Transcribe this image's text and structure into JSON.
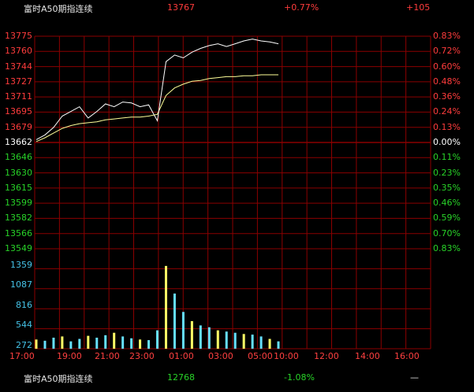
{
  "header": {
    "name": "富时A50期指连续",
    "price": "13767",
    "change_pct": "+0.77%",
    "change_abs": "+105"
  },
  "footer": {
    "name": "富时A50期指连续",
    "price": "12768",
    "change_pct": "-1.08%",
    "extra": "—"
  },
  "colors": {
    "grid": "#8b0000",
    "price_line": "#ffffff",
    "avg_line": "#ffff99",
    "up": "#ff3c3c",
    "down": "#28d228",
    "volume_label": "#45c3e8"
  },
  "chart_data": {
    "type": "line",
    "price_axis": [
      "13775",
      "13760",
      "13744",
      "13727",
      "13711",
      "13695",
      "13679",
      "13662",
      "13646",
      "13630",
      "13615",
      "13599",
      "13582",
      "13566",
      "13549"
    ],
    "pct_axis": [
      "0.83%",
      "0.72%",
      "0.60%",
      "0.48%",
      "0.36%",
      "0.24%",
      "0.13%",
      "0.00%",
      "0.11%",
      "0.23%",
      "0.35%",
      "0.46%",
      "0.59%",
      "0.70%",
      "0.83%"
    ],
    "volume_axis": [
      "1359",
      "1087",
      "816",
      "544",
      "272"
    ],
    "time_axis": [
      "17:00",
      "19:00",
      "21:00",
      "23:00",
      "01:00",
      "03:00",
      "05:00",
      "10:00",
      "12:00",
      "14:00",
      "16:00"
    ],
    "ylim": [
      13549,
      13775
    ],
    "price": [
      13665,
      13670,
      13678,
      13690,
      13695,
      13700,
      13688,
      13695,
      13703,
      13700,
      13705,
      13704,
      13700,
      13702,
      13685,
      13748,
      13755,
      13752,
      13758,
      13762,
      13765,
      13767,
      13764,
      13767,
      13770,
      13772,
      13770,
      13769,
      13767
    ],
    "avg": [
      13663,
      13667,
      13672,
      13677,
      13680,
      13682,
      13683,
      13684,
      13686,
      13687,
      13688,
      13689,
      13689,
      13690,
      13692,
      13712,
      13720,
      13724,
      13727,
      13728,
      13730,
      13731,
      13732,
      13732,
      13733,
      13733,
      13734,
      13734,
      13734
    ],
    "volume": [
      150,
      130,
      180,
      200,
      120,
      160,
      210,
      180,
      220,
      260,
      200,
      170,
      150,
      140,
      300,
      1350,
      900,
      600,
      450,
      380,
      350,
      300,
      280,
      260,
      240,
      230,
      200,
      160,
      120
    ]
  }
}
